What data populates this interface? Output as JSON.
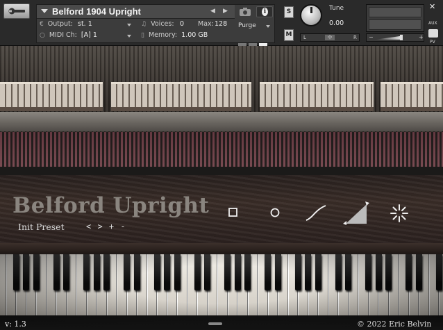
{
  "header": {
    "instrument_title": "Belford 1904 Upright",
    "output_label": "Output:",
    "output_value": "st. 1",
    "voices_label": "Voices:",
    "voices_value": "0",
    "max_label": "Max:",
    "max_value": "128",
    "midi_label": "MIDI Ch:",
    "midi_value": "[A] 1",
    "memory_label": "Memory:",
    "memory_value": "1.00 GB",
    "purge_label": "Purge",
    "solo_label": "S",
    "mute_label": "M",
    "tune_label": "Tune",
    "tune_value": "0.00",
    "pan_left": "L",
    "pan_center": "‹|›",
    "pan_right": "R",
    "vol_minus": "−",
    "vol_plus": "+",
    "close": "✕",
    "aux_label": "AUX",
    "pv_label": "PV",
    "info_glyph": "i"
  },
  "instrument": {
    "title": "Belford Upright",
    "preset": "Init Preset",
    "preset_nav": "< > + -"
  },
  "footer": {
    "version": "v: 1.3",
    "copyright": "© 2022 Eric Belvin"
  },
  "icons": {
    "wrench": "wrench-icon",
    "camera": "camera-icon",
    "info": "info-icon",
    "fx": [
      "square-icon",
      "circle-icon",
      "curve-icon",
      "ramp-icon",
      "sparkle-icon"
    ]
  }
}
